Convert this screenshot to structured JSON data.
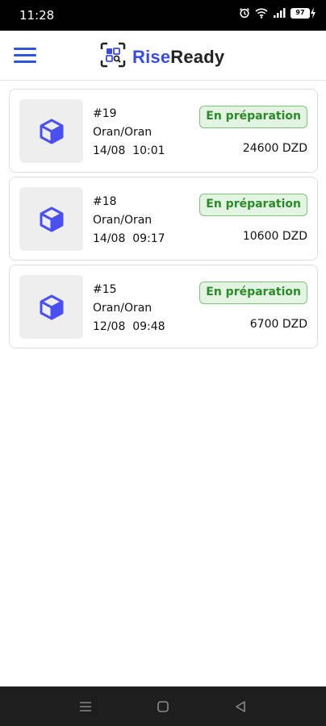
{
  "status_bar": {
    "time": "11:28",
    "battery": "97",
    "icons": [
      "alarm-icon",
      "wifi-icon",
      "signal-icon",
      "battery-icon"
    ]
  },
  "header": {
    "brand_part1": "Rise",
    "brand_part2": "Ready",
    "menu_icon": "hamburger-menu-icon",
    "accent_color": "#3d4cd8"
  },
  "orders": [
    {
      "id": "#19",
      "city": "Oran/Oran",
      "date": "14/08  10:01",
      "status": "En préparation",
      "price": "24600 DZD",
      "icon": "package-cube-icon"
    },
    {
      "id": "#18",
      "city": "Oran/Oran",
      "date": "14/08  09:17",
      "status": "En préparation",
      "price": "10600 DZD",
      "icon": "package-cube-icon"
    },
    {
      "id": "#15",
      "city": "Oran/Oran",
      "date": "12/08  09:48",
      "status": "En préparation",
      "price": "6700 DZD",
      "icon": "package-cube-icon"
    }
  ],
  "nav_bar": {
    "buttons": [
      "recent-apps-icon",
      "home-icon",
      "back-icon"
    ]
  },
  "colors": {
    "status_badge_bg": "#e4f4e2",
    "status_badge_text": "#2b8a2a",
    "icon_blue": "#4a4ff0"
  }
}
